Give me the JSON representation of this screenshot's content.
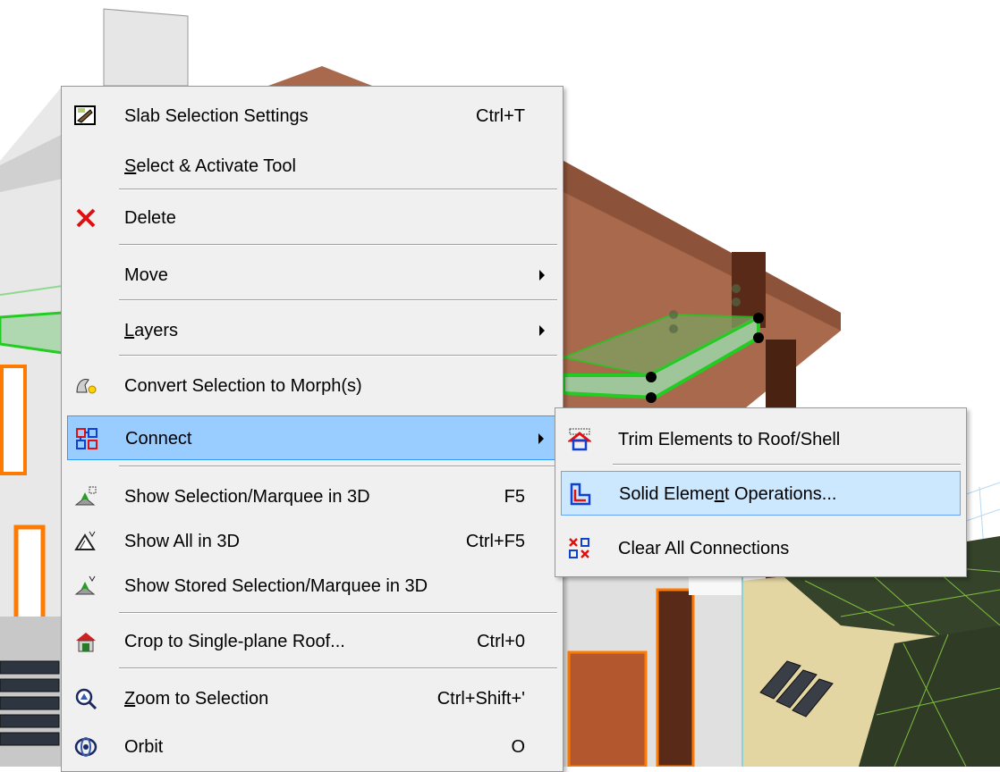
{
  "main_menu": {
    "items": [
      {
        "label": "Slab Selection Settings",
        "shortcut": "Ctrl+T",
        "icon": "slab-settings-icon"
      },
      {
        "label_pre": "",
        "label_u": "S",
        "label_post": "elect & Activate Tool"
      },
      {
        "label": "Delete",
        "icon": "delete-x-icon"
      },
      {
        "label": "Move",
        "submenu": true
      },
      {
        "label_pre": "",
        "label_u": "L",
        "label_post": "ayers",
        "submenu": true
      },
      {
        "label": "Convert Selection to Morph(s)",
        "icon": "morph-icon"
      },
      {
        "label": "Connect",
        "submenu": true,
        "icon": "connect-icon"
      },
      {
        "label": "Show Selection/Marquee in 3D",
        "shortcut": "F5",
        "icon": "show-selection-3d-icon"
      },
      {
        "label": "Show All in 3D",
        "shortcut": "Ctrl+F5",
        "icon": "show-all-3d-icon"
      },
      {
        "label": "Show Stored Selection/Marquee in 3D",
        "icon": "stored-selection-3d-icon"
      },
      {
        "label": "Crop to Single-plane Roof...",
        "shortcut": "Ctrl+0",
        "icon": "crop-roof-icon"
      },
      {
        "label_pre": "",
        "label_u": "Z",
        "label_post": "oom to Selection",
        "shortcut": "Ctrl+Shift+'",
        "icon": "zoom-selection-icon"
      },
      {
        "label": "Orbit",
        "shortcut": "O",
        "icon": "orbit-icon"
      }
    ]
  },
  "sub_menu": {
    "items": [
      {
        "label": "Trim Elements to Roof/Shell",
        "icon": "trim-roof-icon"
      },
      {
        "label_pre": "Solid Eleme",
        "label_u": "n",
        "label_post": "t Operations...",
        "icon": "solid-operations-icon"
      },
      {
        "label": "Clear All Connections",
        "icon": "clear-connections-icon"
      }
    ]
  },
  "colors": {
    "highlight": "#99ccff",
    "highlight_light": "#cce8ff",
    "menu_bg": "#f0f0f0",
    "roof": "#a0674c",
    "terrain": "#2b3a22",
    "selection_green": "#22cc22"
  }
}
